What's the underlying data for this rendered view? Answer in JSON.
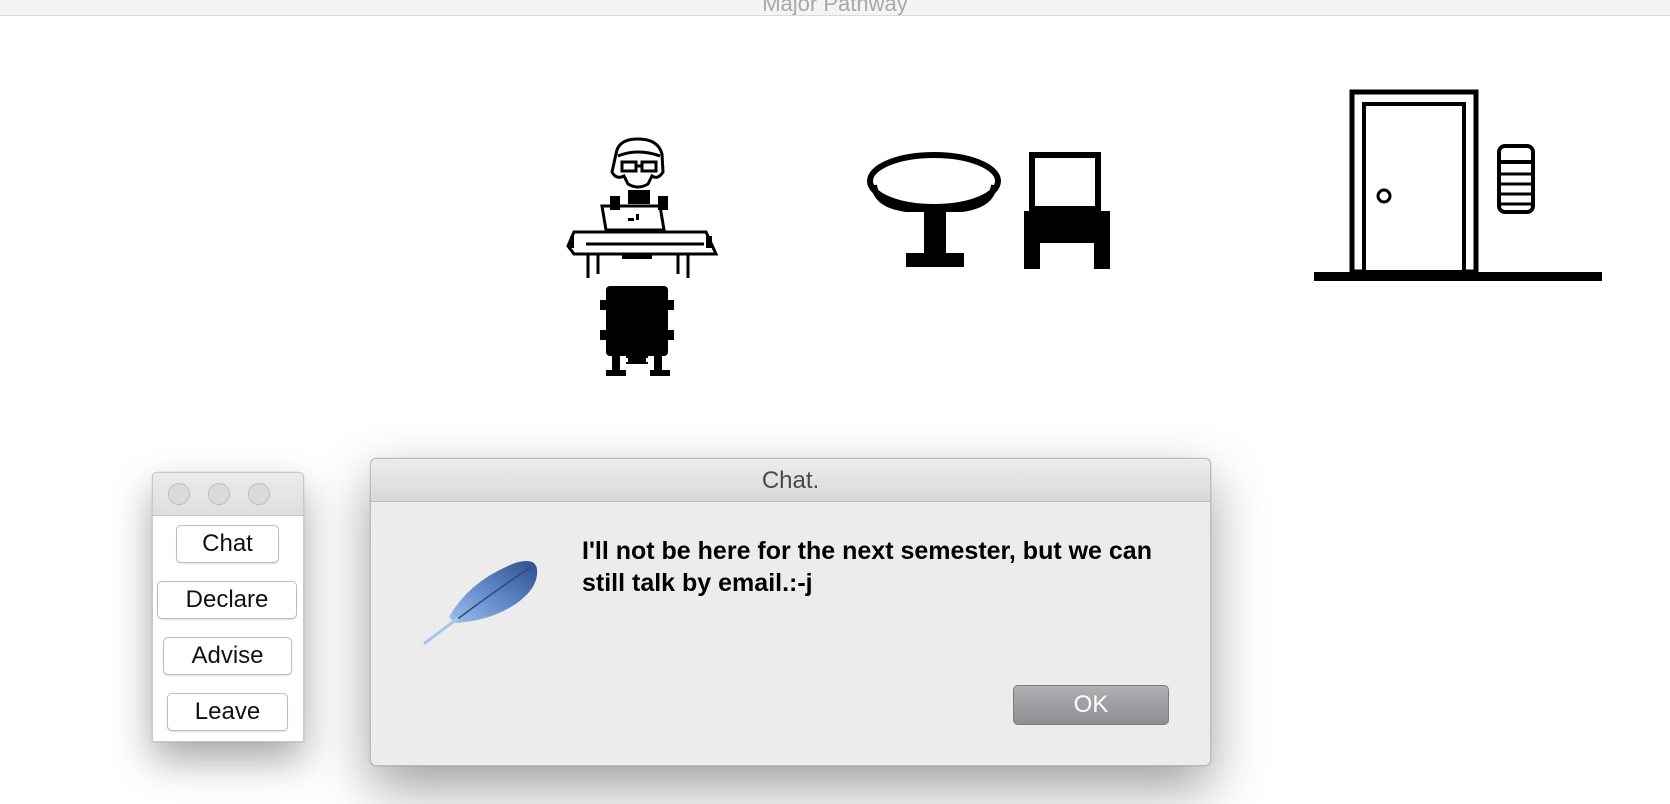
{
  "window": {
    "title": "Major Pathway"
  },
  "scene": {
    "objects": [
      "advisor-at-desk",
      "round-table",
      "chair",
      "door",
      "light-switch"
    ]
  },
  "menu": {
    "buttons": [
      "Chat",
      "Declare",
      "Advise",
      "Leave"
    ]
  },
  "dialog": {
    "title": "Chat.",
    "icon": "feather-icon",
    "message": "I'll not be here for the next semester, but we can still talk by email.:-j",
    "ok_label": "OK"
  }
}
